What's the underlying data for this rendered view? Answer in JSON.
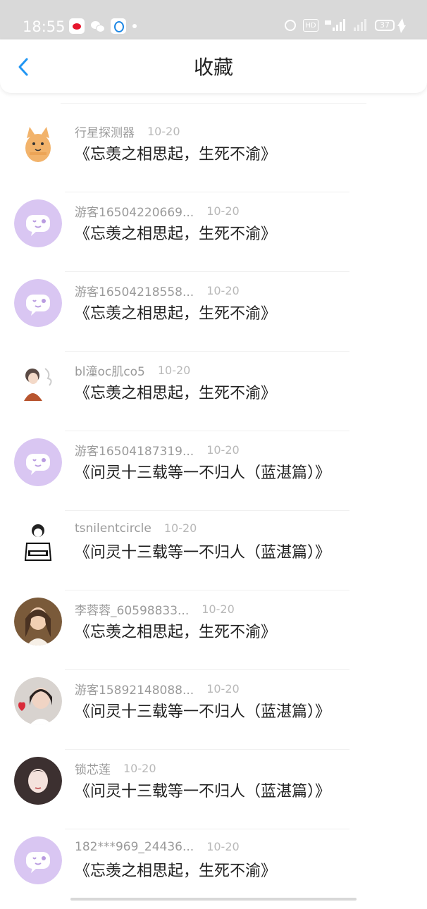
{
  "status_bar": {
    "time": "18:55",
    "battery": "37",
    "hd": "HD"
  },
  "header": {
    "title": "收藏",
    "back_icon": "chevron-left-icon",
    "accent_color": "#2196f3"
  },
  "items": [
    {
      "user": "行星探测器",
      "date": "10-20",
      "title": "《忘羡之相思起，生死不渝》",
      "avatar": "cat-illustration"
    },
    {
      "user": "游客16504220669...",
      "date": "10-20",
      "title": "《忘羡之相思起，生死不渝》",
      "avatar": "default-chat-bubble"
    },
    {
      "user": "游客16504218558...",
      "date": "10-20",
      "title": "《忘羡之相思起，生死不渝》",
      "avatar": "default-chat-bubble"
    },
    {
      "user": "bl潼oc肌co5",
      "date": "10-20",
      "title": "《忘羡之相思起，生死不渝》",
      "avatar": "girl-sketch"
    },
    {
      "user": "游客16504187319...",
      "date": "10-20",
      "title": "《问灵十三载等一不归人（蓝湛篇）》",
      "avatar": "default-chat-bubble"
    },
    {
      "user": "tsnilentcircle",
      "date": "10-20",
      "title": "《问灵十三载等一不归人（蓝湛篇）》",
      "avatar": "line-drawing"
    },
    {
      "user": "李蓉蓉_60598833...",
      "date": "10-20",
      "title": "《忘羡之相思起，生死不渝》",
      "avatar": "photo-woman"
    },
    {
      "user": "游客15892148088...",
      "date": "10-20",
      "title": "《问灵十三载等一不归人（蓝湛篇）》",
      "avatar": "photo-woman-heart"
    },
    {
      "user": "锁芯莲",
      "date": "10-20",
      "title": "《问灵十三载等一不归人（蓝湛篇）》",
      "avatar": "photo-woman-pale"
    },
    {
      "user": "182***969_24436...",
      "date": "10-20",
      "title": "《忘羡之相思起，生死不渝》",
      "avatar": "default-chat-bubble"
    }
  ]
}
